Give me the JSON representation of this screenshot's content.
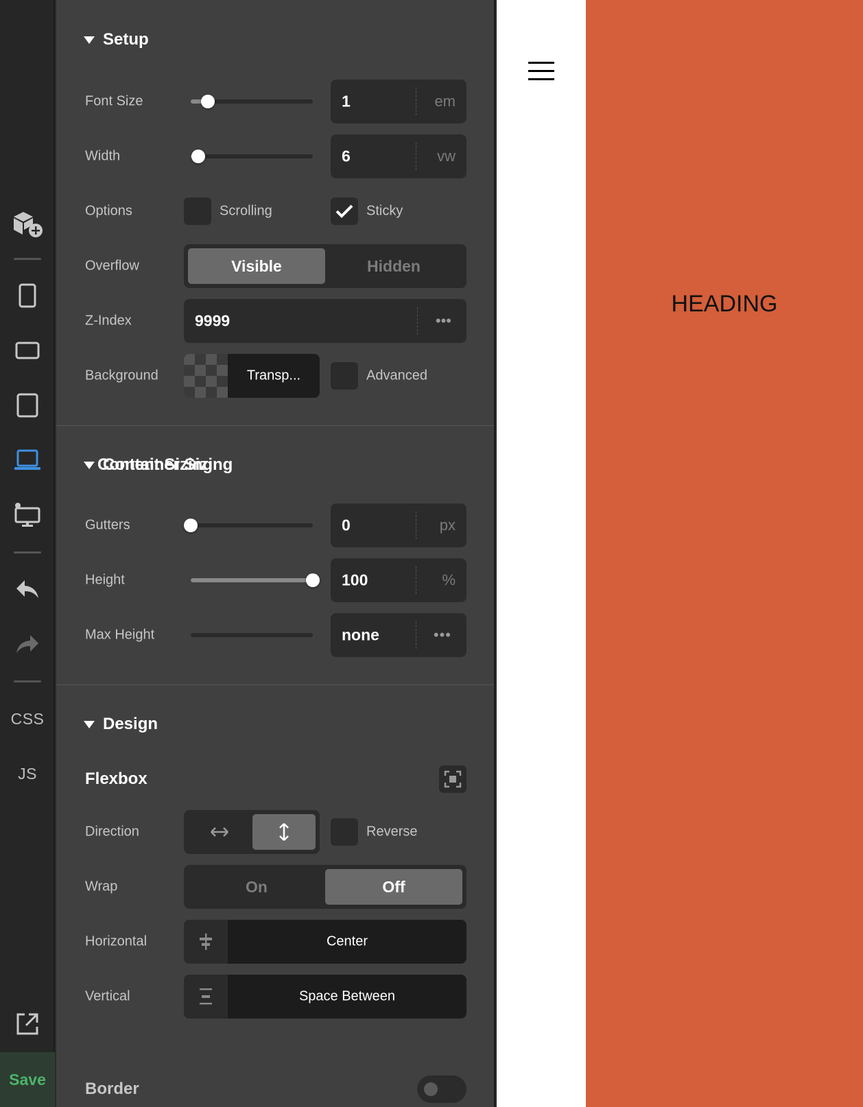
{
  "toolbar": {
    "css_label": "CSS",
    "js_label": "JS",
    "save_label": "Save"
  },
  "setup": {
    "title": "Setup",
    "font_size": {
      "label": "Font Size",
      "value": "1",
      "unit": "em",
      "slider_fraction": 0.14
    },
    "width": {
      "label": "Width",
      "value": "6",
      "unit": "vw",
      "slider_fraction": 0.06
    },
    "options": {
      "label": "Options",
      "scrolling_label": "Scrolling",
      "scrolling_checked": false,
      "sticky_label": "Sticky",
      "sticky_checked": true
    },
    "overflow": {
      "label": "Overflow",
      "options": [
        "Visible",
        "Hidden"
      ],
      "selected": "Visible"
    },
    "z_index": {
      "label": "Z-Index",
      "value": "9999"
    },
    "background": {
      "label": "Background",
      "value": "Transp...",
      "advanced_label": "Advanced",
      "advanced_checked": false
    }
  },
  "container_sizing": {
    "title_overlap_a": "Content Sizing",
    "title_overlap_b": "Container Sizing",
    "gutters": {
      "label": "Gutters",
      "value": "0",
      "unit": "px",
      "slider_fraction": 0.0
    },
    "height": {
      "label": "Height",
      "value": "100",
      "unit": "%",
      "slider_fraction": 1.0
    },
    "max_height": {
      "label": "Max Height",
      "value": "none"
    }
  },
  "design": {
    "title": "Design",
    "flexbox_label": "Flexbox",
    "direction": {
      "label": "Direction",
      "selected": "vertical",
      "reverse_label": "Reverse",
      "reverse_checked": false
    },
    "wrap": {
      "label": "Wrap",
      "options": [
        "On",
        "Off"
      ],
      "selected": "Off"
    },
    "horizontal": {
      "label": "Horizontal",
      "value": "Center"
    },
    "vertical": {
      "label": "Vertical",
      "value": "Space Between"
    },
    "border": {
      "label": "Border",
      "enabled": false
    }
  },
  "preview": {
    "heading": "HEADING"
  },
  "colors": {
    "accent_blue": "#3d8fe0",
    "save_green": "#4db36a",
    "preview_orange": "#d45f3a"
  },
  "icons": [
    "add-block-icon",
    "phone-portrait-icon",
    "phone-landscape-icon",
    "tablet-icon",
    "laptop-icon",
    "desktop-icon",
    "undo-icon",
    "redo-icon",
    "external-link-icon",
    "checkmark-icon",
    "horizontal-arrows-icon",
    "vertical-arrows-icon",
    "align-center-icon",
    "distribute-vertical-icon",
    "focus-frame-icon",
    "hamburger-menu-icon"
  ]
}
